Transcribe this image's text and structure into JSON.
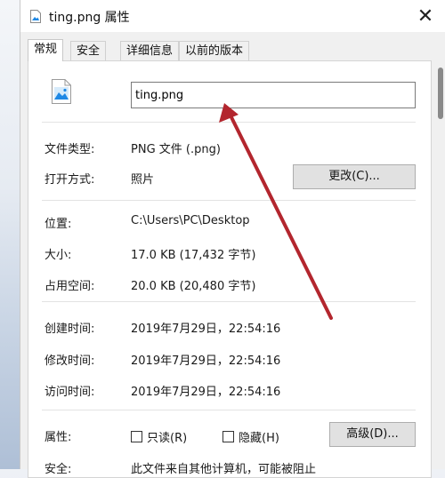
{
  "window": {
    "title": "ting.png 属性",
    "close_symbol": "✕"
  },
  "tabs": [
    {
      "label": "常规",
      "active": true
    },
    {
      "label": "安全",
      "active": false
    },
    {
      "label": "详细信息",
      "active": false
    },
    {
      "label": "以前的版本",
      "active": false
    }
  ],
  "general": {
    "file_name": "ting.png",
    "file_type_label": "文件类型:",
    "file_type_value": "PNG 文件 (.png)",
    "open_with_label": "打开方式:",
    "open_with_value": "照片",
    "change_button": "更改(C)...",
    "location_label": "位置:",
    "location_value": "C:\\Users\\PC\\Desktop",
    "size_label": "大小:",
    "size_value": "17.0 KB (17,432 字节)",
    "size_on_disk_label": "占用空间:",
    "size_on_disk_value": "20.0 KB (20,480 字节)",
    "created_label": "创建时间:",
    "created_value": "2019年7月29日，22:54:16",
    "modified_label": "修改时间:",
    "modified_value": "2019年7月29日，22:54:16",
    "accessed_label": "访问时间:",
    "accessed_value": "2019年7月29日，22:54:16",
    "attributes_label": "属性:",
    "readonly_label": "只读(R)",
    "hidden_label": "隐藏(H)",
    "advanced_button": "高级(D)...",
    "security_label": "安全:",
    "security_value": "此文件来自其他计算机，可能被阻止"
  },
  "colors": {
    "annotation_arrow": "#b3262e",
    "icon_blue": "#1e88e5"
  },
  "icons": [
    "image-file-icon",
    "close-icon",
    "annotation-arrow"
  ]
}
